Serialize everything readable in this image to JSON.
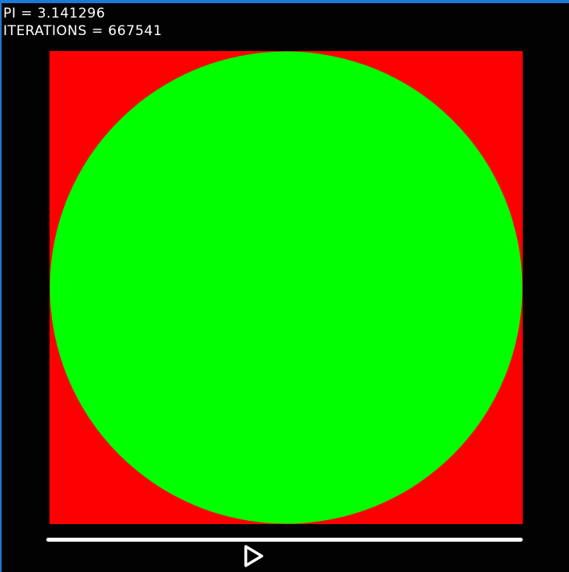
{
  "hud": {
    "pi_line": "PI = 3.141296",
    "iterations_line": "ITERATIONS = 667541"
  },
  "simulation": {
    "inside_color": "#00ff00",
    "outside_color": "#ff0000",
    "background_color": "#000000"
  },
  "controls": {
    "progress": 1.0,
    "play_icon": "play-icon"
  }
}
